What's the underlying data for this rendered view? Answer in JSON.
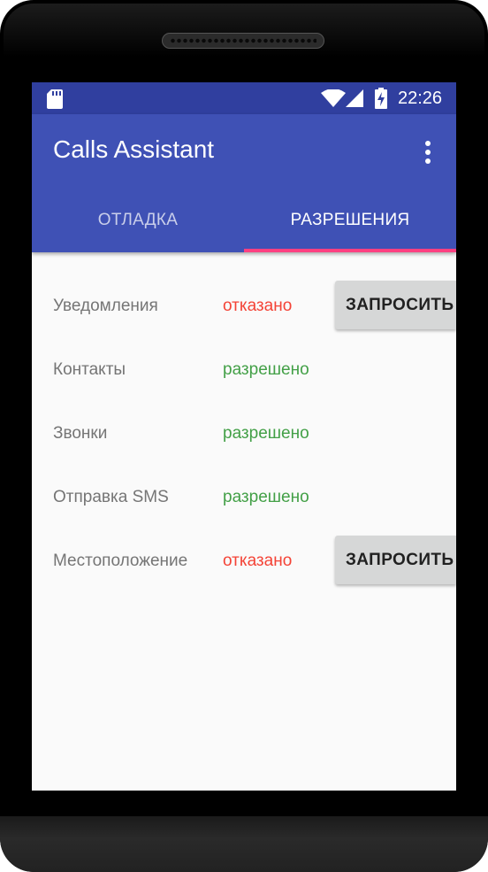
{
  "status_bar": {
    "time": "22:26",
    "icons": [
      "sd-card-icon",
      "wifi-icon",
      "cell-signal-icon",
      "battery-charging-icon"
    ]
  },
  "app_bar": {
    "title": "Calls Assistant",
    "overflow_icon": "more-vert-icon"
  },
  "tabs": [
    {
      "label": "ОТЛАДКА",
      "selected": false
    },
    {
      "label": "РАЗРЕШЕНИЯ",
      "selected": true
    }
  ],
  "permissions": [
    {
      "label": "Уведомления",
      "status": "отказано",
      "granted": false,
      "button": "ЗАПРОСИТЬ"
    },
    {
      "label": "Контакты",
      "status": "разрешено",
      "granted": true
    },
    {
      "label": "Звонки",
      "status": "разрешено",
      "granted": true
    },
    {
      "label": "Отправка SMS",
      "status": "разрешено",
      "granted": true
    },
    {
      "label": "Местоположение",
      "status": "отказано",
      "granted": false,
      "button": "ЗАПРОСИТЬ"
    }
  ],
  "colors": {
    "primary": "#3f51b5",
    "primary_dark": "#303f9f",
    "accent": "#ff4081",
    "denied": "#f44336",
    "granted": "#43a047"
  }
}
